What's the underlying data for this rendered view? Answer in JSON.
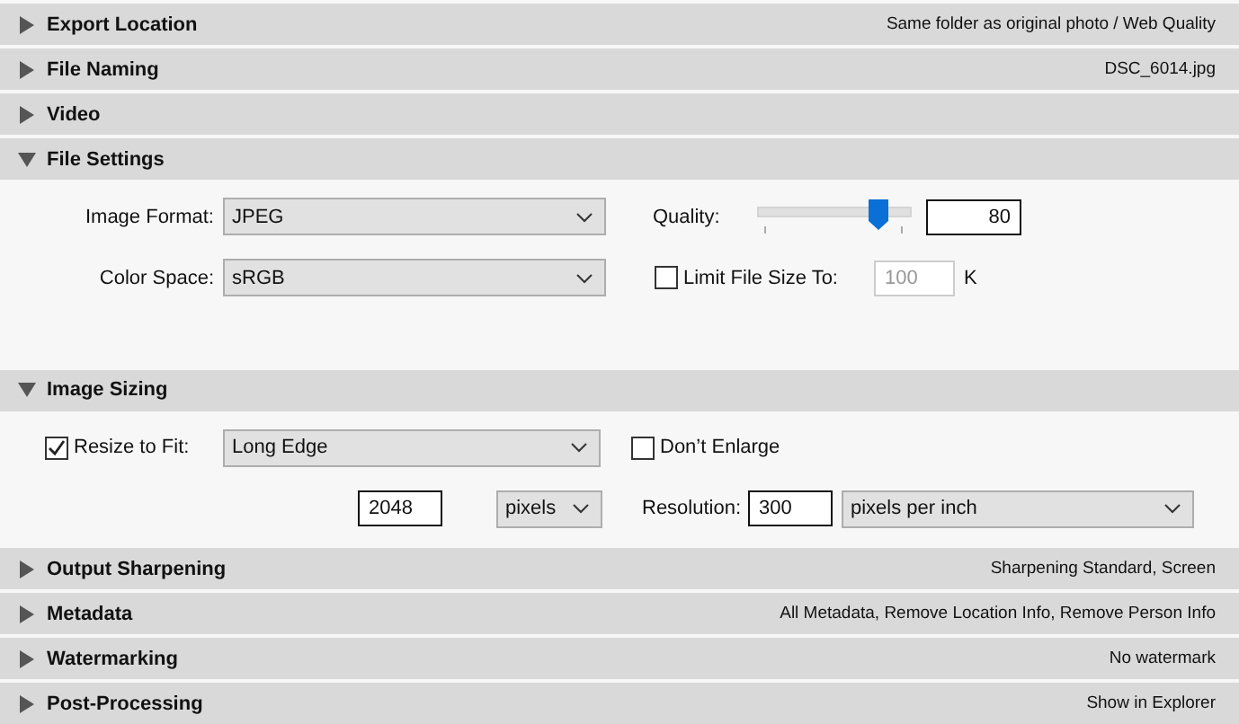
{
  "sections": [
    {
      "kind": "plain",
      "title": "Export Location",
      "summary": "Same folder as original photo / Web Quality",
      "expanded": false
    },
    {
      "kind": "plain",
      "title": "File Naming",
      "summary": "DSC_6014.jpg",
      "expanded": false
    },
    {
      "kind": "plain",
      "title": "Video",
      "expanded": false
    },
    {
      "kind": "file_settings",
      "title": "File Settings",
      "expanded": true,
      "image_format": {
        "label": "Image Format:",
        "value": "JPEG"
      },
      "color_space": {
        "label": "Color Space:",
        "value": "sRGB"
      },
      "quality": {
        "label": "Quality:",
        "level": 0.78,
        "value": "80"
      },
      "limit_file_size": {
        "label": "Limit File Size To:",
        "checked": false,
        "value": "100",
        "unit": "K"
      }
    },
    {
      "kind": "image_sizing",
      "title": "Image Sizing",
      "expanded": true,
      "resize_to_fit": {
        "label": "Resize to Fit:",
        "checked": true,
        "value": "Long Edge"
      },
      "dont_enlarge": {
        "label": "Don’t Enlarge",
        "checked": false
      },
      "size": {
        "value": "2048",
        "unit": "pixels"
      },
      "resolution": {
        "label": "Resolution:",
        "value": "300",
        "unit": "pixels per inch"
      }
    },
    {
      "kind": "plain",
      "title": "Output Sharpening",
      "summary": "Sharpening Standard, Screen",
      "expanded": false
    },
    {
      "kind": "plain",
      "title": "Metadata",
      "summary": "All Metadata, Remove Location Info, Remove Person Info",
      "expanded": false
    },
    {
      "kind": "plain",
      "title": "Watermarking",
      "summary": "No watermark",
      "expanded": false
    },
    {
      "kind": "plain",
      "title": "Post-Processing",
      "summary": "Show in Explorer",
      "expanded": false
    }
  ]
}
